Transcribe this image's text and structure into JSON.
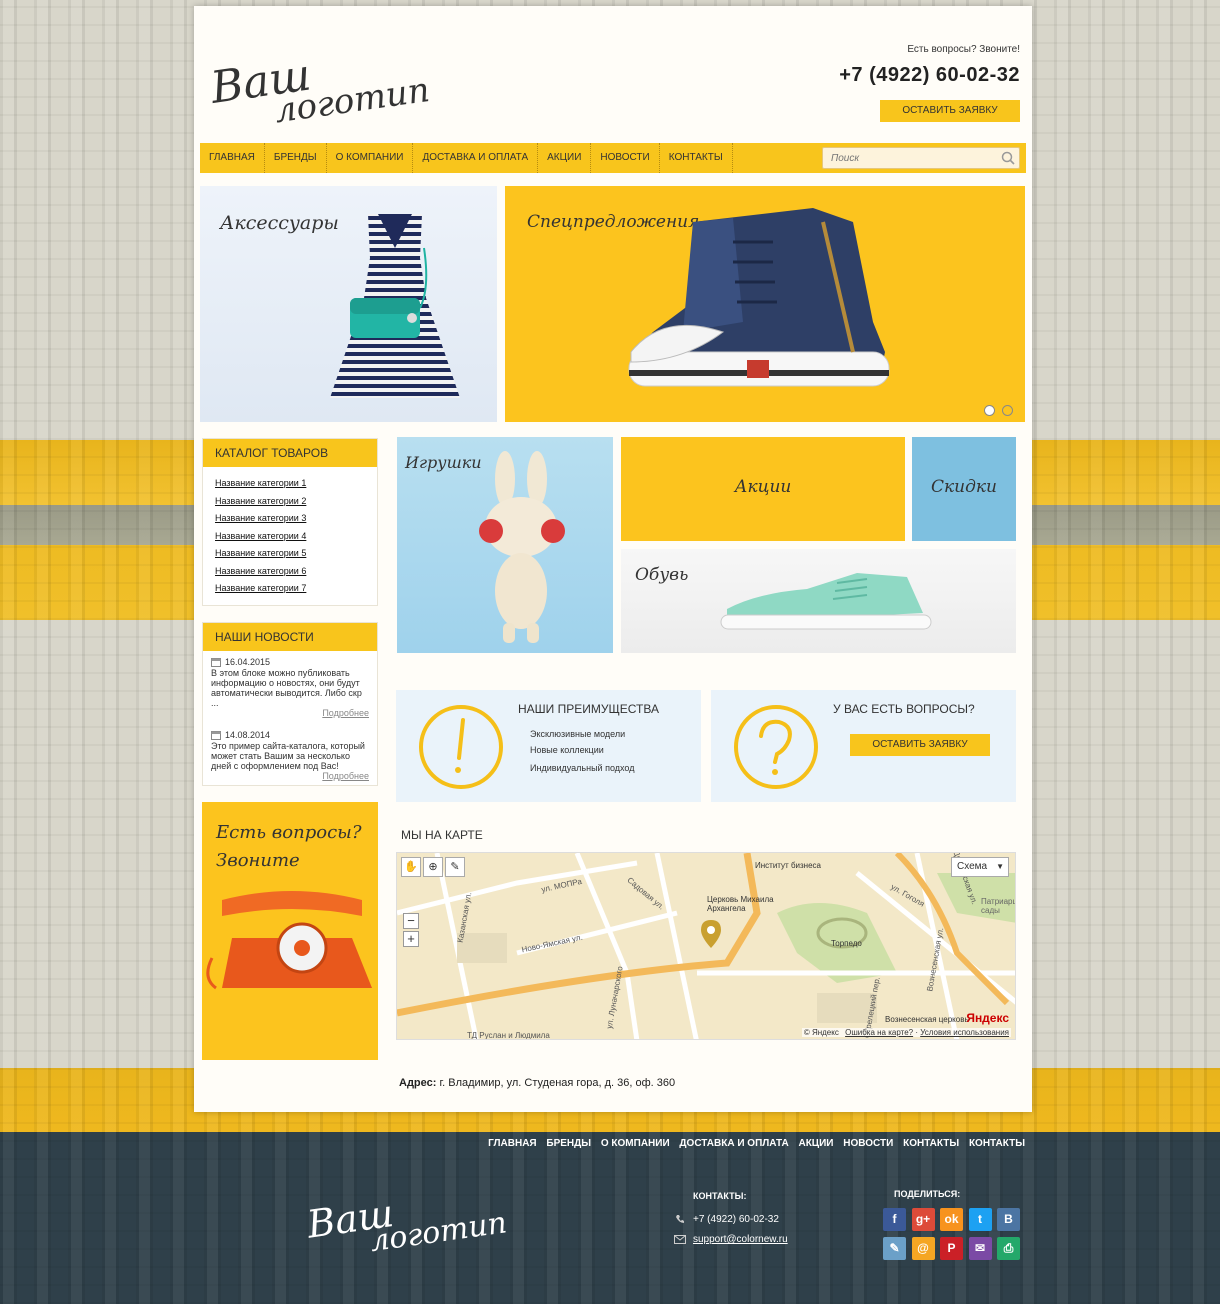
{
  "header": {
    "logo_line1": "Ваш",
    "logo_line2": "логотип",
    "question": "Есть вопросы? Звоните!",
    "phone": "+7 (4922) 60-02-32",
    "cta": "ОСТАВИТЬ ЗАЯВКУ"
  },
  "nav": {
    "items": [
      "ГЛАВНАЯ",
      "БРЕНДЫ",
      "О КОМПАНИИ",
      "ДОСТАВКА И ОПЛАТА",
      "АКЦИИ",
      "НОВОСТИ",
      "КОНТАКТЫ"
    ],
    "search_placeholder": "Поиск"
  },
  "banners": {
    "accessories": "Аксессуары",
    "special": "Спецпредложения"
  },
  "tiles": {
    "toys": "Игрушки",
    "promo": "Акции",
    "discounts": "Скидки",
    "shoes": "Обувь"
  },
  "catalog": {
    "title": "КАТАЛОГ ТОВАРОВ",
    "items": [
      "Название категории 1",
      "Название категории 2",
      "Название категории 3",
      "Название категории 4",
      "Название категории 5",
      "Название категории 6",
      "Название категории 7"
    ]
  },
  "news": {
    "title": "НАШИ НОВОСТИ",
    "items": [
      {
        "date": "16.04.2015",
        "text": "В этом блоке можно публиковать информацию о новостях, они будут автоматически выводится. Либо скр ...",
        "more": "Подробнее"
      },
      {
        "date": "14.08.2014",
        "text": "Это пример сайта-каталога, который может стать Вашим за несколько дней с оформлением под Вас!",
        "more": "Подробнее"
      }
    ]
  },
  "call_promo": {
    "line1": "Есть вопросы?",
    "line2": "Звоните"
  },
  "advantages": {
    "title": "НАШИ ПРЕИМУЩЕСТВА",
    "items": [
      "Эксклюзивные модели",
      "Новые коллекции",
      "Индивидуальный подход"
    ]
  },
  "questions": {
    "title": "У ВАС ЕСТЬ ВОПРОСЫ?",
    "cta": "ОСТАВИТЬ ЗАЯВКУ"
  },
  "map": {
    "title": "МЫ НА КАРТЕ",
    "mode": "Схема",
    "labels": [
      "Институт бизнеса",
      "Церковь Михаила Архангела",
      "Торпедо",
      "Вознесенская церковь",
      "Патриаршие сады",
      "ул. МОПРа",
      "Садовая ул.",
      "Ново-Ямская ул.",
      "Казанская ул.",
      "ул. Гоголя",
      "Вознесенская ул.",
      "ул. Луначарского",
      "ТД Руслан и Людмила",
      "Дворянская ул.",
      "Стрелецкий пер."
    ],
    "yandex": "Яндекс",
    "copy": "© Яндекс",
    "error_link": "Ошибка на карте?",
    "terms": "Условия использования"
  },
  "address": {
    "label": "Адрес:",
    "value": "г. Владимир, ул. Студеная гора, д. 36, оф. 360"
  },
  "footer": {
    "nav": [
      "ГЛАВНАЯ",
      "БРЕНДЫ",
      "О КОМПАНИИ",
      "ДОСТАВКА И ОПЛАТА",
      "АКЦИИ",
      "НОВОСТИ",
      "КОНТАКТЫ",
      "КОНТАКТЫ"
    ],
    "contacts_title": "КОНТАКТЫ:",
    "phone": "+7 (4922) 60-02-32",
    "email": "support@colornew.ru",
    "share_title": "ПОДЕЛИТЬСЯ:",
    "socials": [
      {
        "name": "facebook",
        "glyph": "f",
        "color": "#3b5998"
      },
      {
        "name": "google-plus",
        "glyph": "g+",
        "color": "#dd4b39"
      },
      {
        "name": "odnoklassniki",
        "glyph": "ok",
        "color": "#f7931e"
      },
      {
        "name": "twitter",
        "glyph": "t",
        "color": "#1da1f2"
      },
      {
        "name": "vkontakte",
        "glyph": "B",
        "color": "#4c75a3"
      },
      {
        "name": "livejournal",
        "glyph": "✎",
        "color": "#6ba0c8"
      },
      {
        "name": "mail-ru",
        "glyph": "@",
        "color": "#f5a623"
      },
      {
        "name": "pinterest",
        "glyph": "P",
        "color": "#cb2027"
      },
      {
        "name": "email",
        "glyph": "✉",
        "color": "#7b4aa5"
      },
      {
        "name": "print",
        "glyph": "⎙",
        "color": "#24a86a"
      }
    ]
  },
  "colors": {
    "accent": "#f8c51c",
    "footer_bg": "#2f404a",
    "blue_tile": "#7ec0e0"
  }
}
